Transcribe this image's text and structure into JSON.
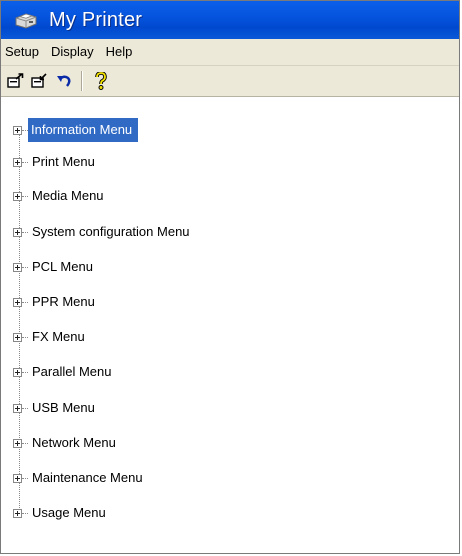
{
  "window": {
    "title": "My Printer",
    "icon": "printer-icon"
  },
  "menubar": {
    "items": [
      {
        "label": "Setup"
      },
      {
        "label": "Display"
      },
      {
        "label": "Help"
      }
    ]
  },
  "toolbar": {
    "buttons": [
      {
        "icon": "upload-settings-icon"
      },
      {
        "icon": "download-settings-icon"
      },
      {
        "icon": "undo-icon"
      },
      {
        "icon": "help-icon"
      }
    ]
  },
  "tree": {
    "selected_index": 0,
    "items": [
      {
        "label": "Information Menu"
      },
      {
        "label": "Print Menu"
      },
      {
        "label": "Media Menu"
      },
      {
        "label": "System configuration Menu"
      },
      {
        "label": "PCL Menu"
      },
      {
        "label": "PPR Menu"
      },
      {
        "label": "FX Menu"
      },
      {
        "label": "Parallel Menu"
      },
      {
        "label": "USB Menu"
      },
      {
        "label": "Network Menu"
      },
      {
        "label": "Maintenance Menu"
      },
      {
        "label": "Usage Menu"
      }
    ]
  },
  "colors": {
    "titlebar": "#0055e5",
    "selection": "#316ac5",
    "chrome": "#ece9d8"
  }
}
